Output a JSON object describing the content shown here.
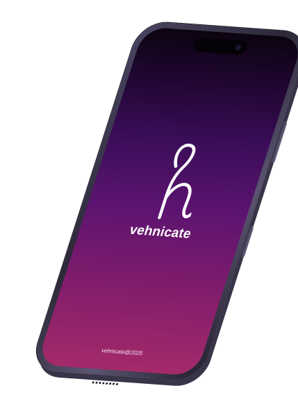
{
  "app": {
    "brand_name": "vehnicate",
    "copyright": "vehnicate@2025"
  },
  "logo": {
    "icon": "h-monogram-icon",
    "color": "#ffffff"
  },
  "theme": {
    "gradient_top": "#0c0410",
    "gradient_mid": "#5c1470",
    "gradient_bottom": "#a42a6a",
    "device_frame": "#4a4460"
  }
}
